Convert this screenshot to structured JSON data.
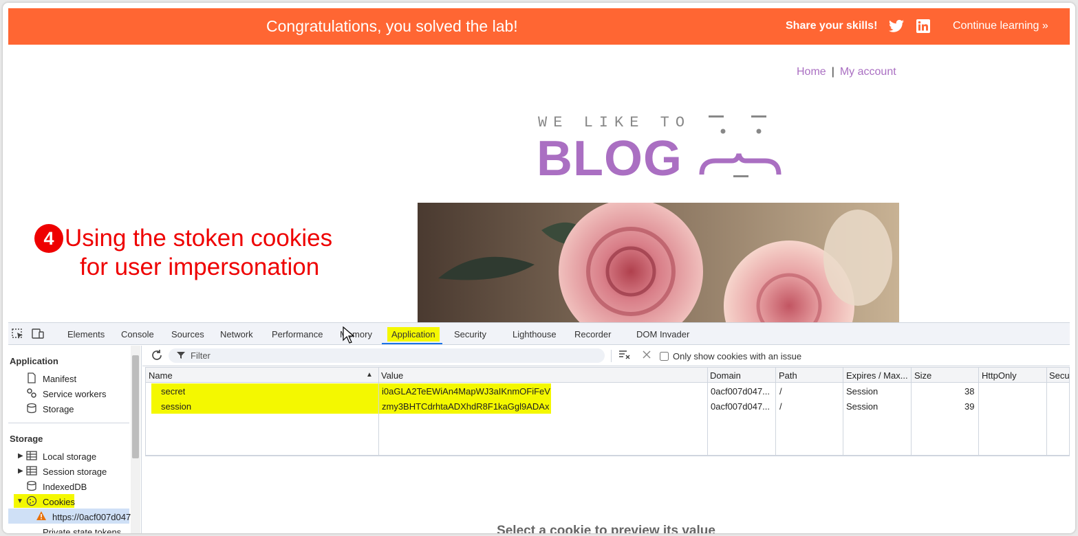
{
  "banner": {
    "message": "Congratulations, you solved the lab!",
    "share": "Share your skills!",
    "continue": "Continue learning »",
    "color": "#ff6633"
  },
  "site_nav": {
    "home": "Home",
    "separator": "|",
    "account": "My account"
  },
  "logo": {
    "top": "WE LIKE TO",
    "main": "BLOG"
  },
  "annotation": {
    "number": "4",
    "line1": "Using the stoken cookies",
    "line2": "for user impersonation"
  },
  "devtools": {
    "tabs": [
      "Elements",
      "Console",
      "Sources",
      "Network",
      "Performance",
      "Memory",
      "Application",
      "Security",
      "Lighthouse",
      "Recorder",
      "DOM Invader"
    ],
    "active_tab": "Application",
    "sidebar": {
      "application_header": "Application",
      "application_items": [
        "Manifest",
        "Service workers",
        "Storage"
      ],
      "storage_header": "Storage",
      "storage_items": [
        "Local storage",
        "Session storage",
        "IndexedDB",
        "Cookies"
      ],
      "cookie_origin": "https://0acf007d047",
      "partial_item": "Private state tokens"
    },
    "toolbar": {
      "filter_placeholder": "Filter",
      "only_issues": "Only show cookies with an issue"
    },
    "columns": [
      "Name",
      "Value",
      "Domain",
      "Path",
      "Expires / Max...",
      "Size",
      "HttpOnly",
      "Secure"
    ],
    "cookies": [
      {
        "name": "secret",
        "value": "i0aGLA2TeEWiAn4MapWJ3aIKnmOFiFeV",
        "domain": "0acf007d047...",
        "path": "/",
        "expires": "Session",
        "size": "38"
      },
      {
        "name": "session",
        "value": "zmy3BHTCdrhtaADXhdR8F1kaGgl9ADAx",
        "domain": "0acf007d047...",
        "path": "/",
        "expires": "Session",
        "size": "39"
      }
    ],
    "preview_text": "Select a cookie to preview its value"
  }
}
